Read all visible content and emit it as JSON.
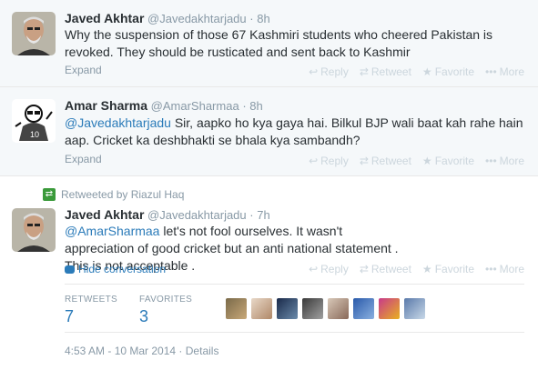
{
  "tweets": [
    {
      "name": "Javed Akhtar",
      "handle": "@Javedakhtarjadu",
      "time": "8h",
      "text": "Why the suspension of those 67 Kashmiri students who cheered Pakistan is revoked. They should be rusticated and sent back to Kashmir",
      "expand": "Expand"
    },
    {
      "name": "Amar Sharma",
      "handle": "@AmarSharmaa",
      "time": "8h",
      "mention": "@Javedakhtarjadu",
      "text": " Sir, aapko ho kya gaya hai. Bilkul BJP wali baat kah rahe hain aap. Cricket ka deshbhakti se bhala kya sambandh?",
      "expand": "Expand"
    },
    {
      "retweeted_by": "Retweeted by Riazul Haq",
      "name": "Javed Akhtar",
      "handle": "@Javedakhtarjadu",
      "time": "7h",
      "mention": "@AmarSharmaa",
      "text": " let's not fool ourselves. It wasn't appreciation of good cricket but an anti national statement . This is not acceptable .",
      "hide_conversation": "Hide conversation",
      "retweets_label": "RETWEETS",
      "retweets_count": "7",
      "favorites_label": "FAVORITES",
      "favorites_count": "3",
      "timestamp": "4:53 AM - 10 Mar 2014",
      "details": "Details"
    }
  ],
  "actions": {
    "reply": "Reply",
    "retweet": "Retweet",
    "favorite": "Favorite",
    "more": "More"
  },
  "separator": "·"
}
